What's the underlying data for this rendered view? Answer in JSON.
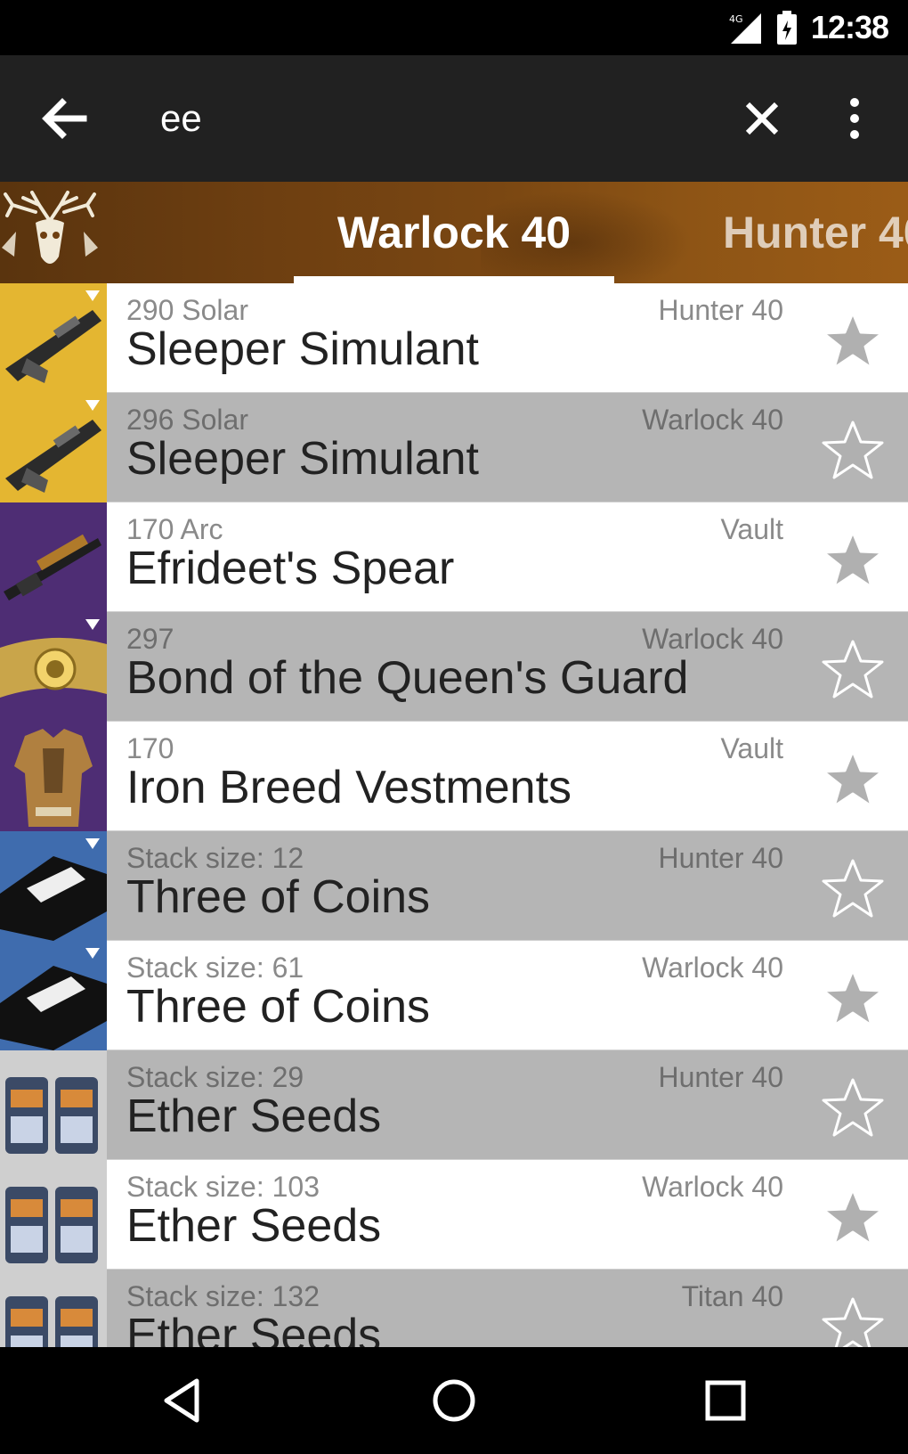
{
  "status_bar": {
    "time": "12:38"
  },
  "toolbar": {
    "search_value": "ee"
  },
  "characters": {
    "active_tab": "Warlock 40",
    "next_tab": "Hunter 40"
  },
  "items": [
    {
      "sub": "290 Solar",
      "location": "Hunter 40",
      "name": "Sleeper Simulant",
      "bg": "#e4b631",
      "icon": "rifle-icon"
    },
    {
      "sub": "296 Solar",
      "location": "Warlock 40",
      "name": "Sleeper Simulant",
      "bg": "#e4b631",
      "icon": "rifle-icon"
    },
    {
      "sub": "170 Arc",
      "location": "Vault",
      "name": "Efrideet's Spear",
      "bg": "#4e2d74",
      "icon": "sniper-rifle-icon"
    },
    {
      "sub": "297",
      "location": "Warlock 40",
      "name": "Bond of the Queen's Guard",
      "bg": "#4e2d74",
      "icon": "warlock-bond-icon"
    },
    {
      "sub": "170",
      "location": "Vault",
      "name": "Iron Breed Vestments",
      "bg": "#4e2d74",
      "icon": "chest-armor-icon"
    },
    {
      "sub": "Stack size: 12",
      "location": "Hunter 40",
      "name": "Three of Coins",
      "bg": "#3f6cae",
      "icon": "coins-icon"
    },
    {
      "sub": "Stack size: 61",
      "location": "Warlock 40",
      "name": "Three of Coins",
      "bg": "#3f6cae",
      "icon": "coins-icon"
    },
    {
      "sub": "Stack size: 29",
      "location": "Hunter 40",
      "name": "Ether Seeds",
      "bg": "#cfcfcf",
      "icon": "ether-seeds-icon"
    },
    {
      "sub": "Stack size: 103",
      "location": "Warlock 40",
      "name": "Ether Seeds",
      "bg": "#cfcfcf",
      "icon": "ether-seeds-icon"
    },
    {
      "sub": "Stack size: 132",
      "location": "Titan 40",
      "name": "Ether Seeds",
      "bg": "#cfcfcf",
      "icon": "ether-seeds-icon"
    }
  ],
  "colors": {
    "toolbar": "#212121",
    "row_alt": "#b5b5b5",
    "row_plain": "#ffffff",
    "star": "#b0b0b0"
  }
}
